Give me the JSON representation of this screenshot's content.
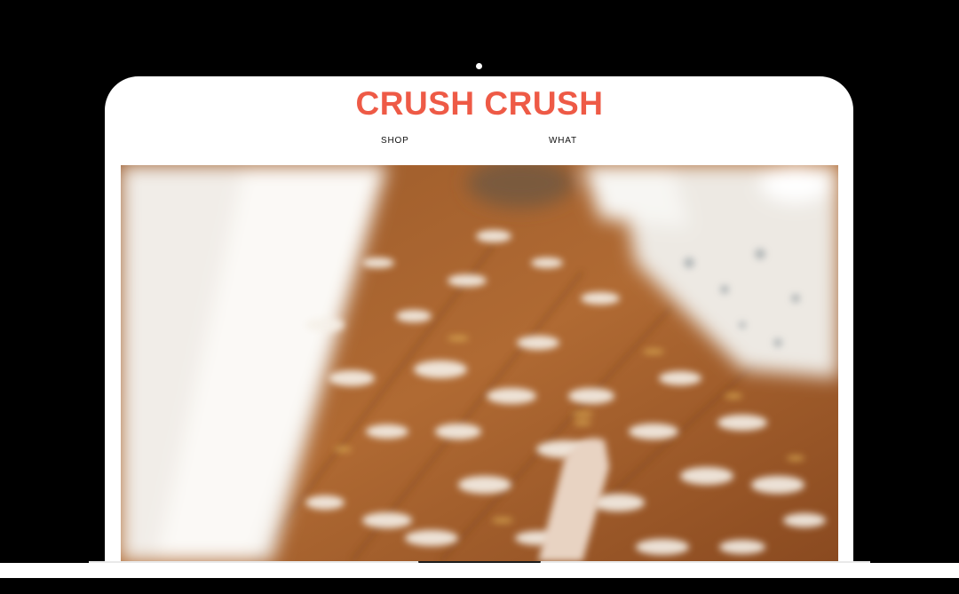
{
  "site": {
    "title": "CRUSH CRUSH",
    "brand_color": "#ee5a46"
  },
  "nav": {
    "items": [
      {
        "label": "SHOP"
      },
      {
        "label": "WHAT"
      }
    ]
  },
  "hero": {
    "image_description": "blurred photo of confetti-covered wooden floor"
  }
}
